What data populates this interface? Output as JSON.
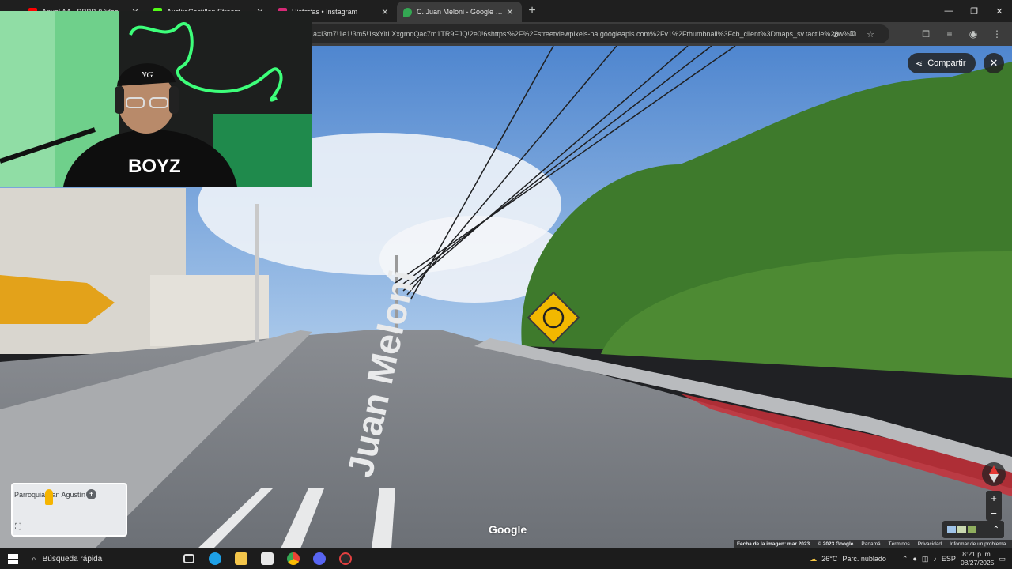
{
  "browser": {
    "tabs": [
      {
        "title": "Anuel AA - BBBB (Video Oficial)",
        "favicon_color": "#ff0000",
        "active": false
      },
      {
        "title": "AxelitoCastillon Stream - Watch",
        "favicon_color": "#53fc18",
        "active": false
      },
      {
        "title": "Historias • Instagram",
        "favicon_color": "#d62976",
        "active": false
      },
      {
        "title": "C. Juan Meloni - Google Maps",
        "favicon_color": "#34a853",
        "active": true
      }
    ],
    "new_tab_glyph": "+",
    "url": "a=l3m7!1e1!3m5!1sxYltLXxgmqQac7m1TR9FJQ!2e0!6shttps:%2F%2Fstreetviewpixels-pa.googleapis.com%2Fv1%2Fthumbnail%3Fcb_client%3Dmaps_sv.tactile%26w%3..."
  },
  "streetview": {
    "share_label": "Compartir",
    "close_glyph": "✕",
    "road_label": "Juan Meloni",
    "google_logo": "Google",
    "minimap": {
      "label": "Parroquia San Agustín"
    },
    "zoom": {
      "in": "+",
      "out": "−"
    },
    "footer": {
      "image_date": "Fecha de la imagen: mar 2023",
      "copyright": "© 2023 Google",
      "links": [
        "Panamá",
        "Términos",
        "Privacidad",
        "Informar de un problema"
      ]
    }
  },
  "webcam": {
    "shirt_text": "BOYZ",
    "cap_text": "NG"
  },
  "taskbar": {
    "search_placeholder": "Búsqueda rápida",
    "weather": {
      "temp": "26°C",
      "condition": "Parc. nublado"
    },
    "lang": "ESP",
    "time": "8:21 p. m.",
    "date": "08/27/2025"
  },
  "colors": {
    "chrome_dark": "#1f1f1f",
    "chrome_toolbar": "#3c3c3c",
    "omnibox": "#282828",
    "sky": "#6fa3dc",
    "road": "#7b7f85",
    "foliage": "#3f7a2c",
    "sign_yellow": "#f2b800",
    "accent_red": "#c8303a"
  }
}
